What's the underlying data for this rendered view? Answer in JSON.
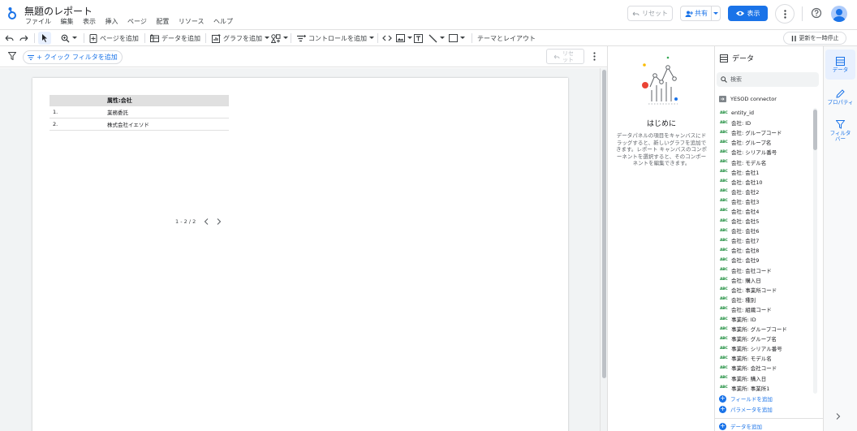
{
  "header": {
    "title": "無題のレポート",
    "menu": [
      "ファイル",
      "編集",
      "表示",
      "挿入",
      "ページ",
      "配置",
      "リソース",
      "ヘルプ"
    ],
    "reset_label": "リセット",
    "share_label": "共有",
    "view_label": "表示"
  },
  "toolbar": {
    "add_page": "ページを追加",
    "add_data": "データを追加",
    "add_chart": "グラフを追加",
    "add_control": "コントロールを追加",
    "theme_layout": "テーマとレイアウト",
    "pause_updates": "更新を一時停止"
  },
  "filterbar": {
    "quick_filter": "+ クイック フィルタを追加",
    "reset": "リセット"
  },
  "table": {
    "header": "属性:会社",
    "rows": [
      {
        "num": "1.",
        "value": "業務委託"
      },
      {
        "num": "2.",
        "value": "株式会社イエソド"
      }
    ],
    "pagination": "1 - 2 / 2"
  },
  "start_panel": {
    "heading": "はじめに",
    "body": "データパネルの項目をキャンバスにドラッグすると、新しいグラフを追加できます。レポート キャンバスのコンポーネントを選択すると、そのコンポーネントを編集できます。"
  },
  "data_panel": {
    "title": "データ",
    "search_placeholder": "検索",
    "source": "YESOD connector",
    "type_badge": "ABC",
    "fields": [
      "entity_id",
      "会社: ID",
      "会社: グループコード",
      "会社: グループ名",
      "会社: シリアル番号",
      "会社: モデル名",
      "会社: 会社1",
      "会社: 会社10",
      "会社: 会社2",
      "会社: 会社3",
      "会社: 会社4",
      "会社: 会社5",
      "会社: 会社6",
      "会社: 会社7",
      "会社: 会社8",
      "会社: 会社9",
      "会社: 会社コード",
      "会社: 購入日",
      "会社: 事業所コード",
      "会社: 種別",
      "会社: 組織コード",
      "事業所: ID",
      "事業所: グループコード",
      "事業所: グループ名",
      "事業所: シリアル番号",
      "事業所: モデル名",
      "事業所: 会社コード",
      "事業所: 購入日",
      "事業所: 事業所1"
    ],
    "add_field": "フィールドを追加",
    "add_parameter": "パラメータを追加",
    "add_data": "データを追加"
  },
  "rail": {
    "data": "データ",
    "properties": "プロパティ",
    "filter_bar": "フィルタバー"
  },
  "colors": {
    "accent": "#1a73e8",
    "field_type": "#1e8e3e"
  }
}
